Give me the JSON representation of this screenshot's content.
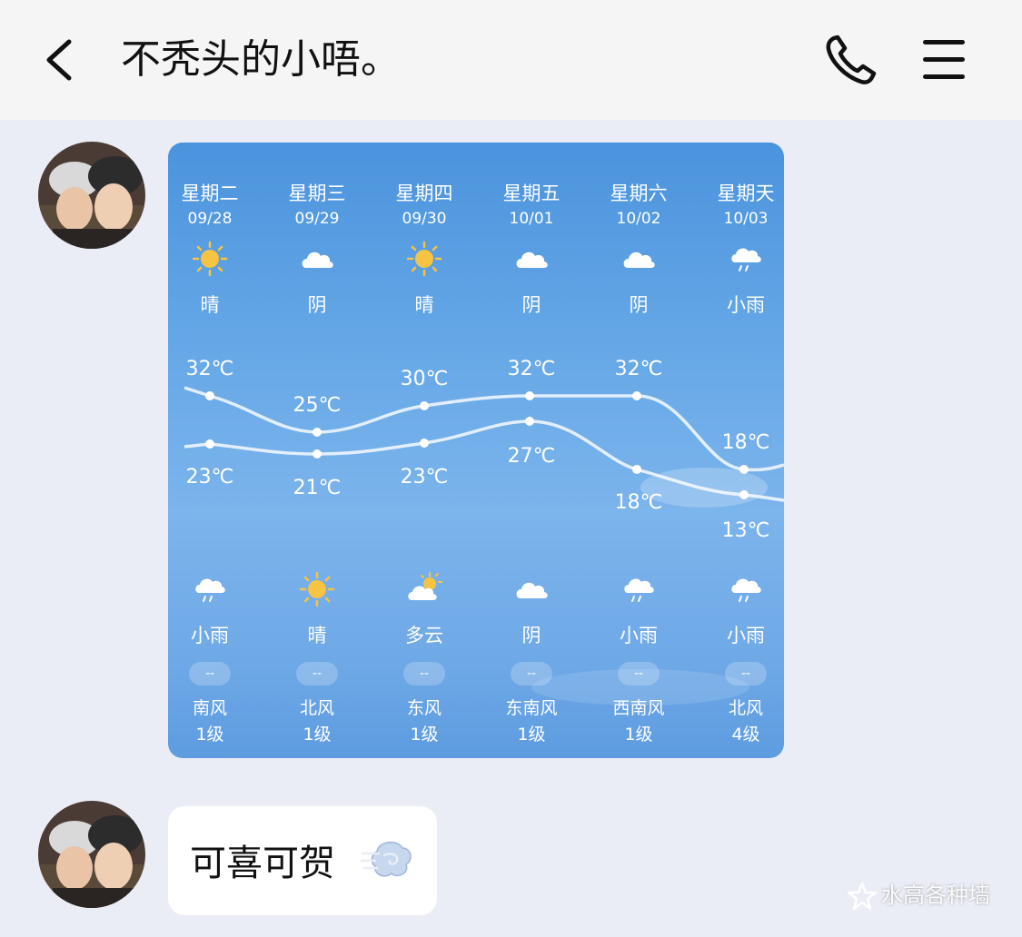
{
  "header": {
    "title": "不秃头的小唔。",
    "back_icon": "chevron-left-icon",
    "call_icon": "phone-icon",
    "menu_icon": "hamburger-menu-icon"
  },
  "messages": [
    {
      "type": "weather-card",
      "avatar": "couple-avatar",
      "days": [
        {
          "weekday": "星期二",
          "date": "09/28",
          "top_icon": "sun-icon",
          "top_condition": "晴",
          "high": "32℃",
          "low": "23℃",
          "bottom_icon": "cloud-rain-icon",
          "bottom_condition": "小雨",
          "wind_speed": "--",
          "wind_direction": "南风",
          "wind_level": "1级"
        },
        {
          "weekday": "星期三",
          "date": "09/29",
          "top_icon": "cloud-icon",
          "top_condition": "阴",
          "high": "25℃",
          "low": "21℃",
          "bottom_icon": "sun-icon",
          "bottom_condition": "晴",
          "wind_speed": "--",
          "wind_direction": "北风",
          "wind_level": "1级"
        },
        {
          "weekday": "星期四",
          "date": "09/30",
          "top_icon": "sun-icon",
          "top_condition": "晴",
          "high": "30℃",
          "low": "23℃",
          "bottom_icon": "partly-cloudy-icon",
          "bottom_condition": "多云",
          "wind_speed": "--",
          "wind_direction": "东风",
          "wind_level": "1级"
        },
        {
          "weekday": "星期五",
          "date": "10/01",
          "top_icon": "cloud-icon",
          "top_condition": "阴",
          "high": "32℃",
          "low": "27℃",
          "bottom_icon": "cloud-icon",
          "bottom_condition": "阴",
          "wind_speed": "--",
          "wind_direction": "东南风",
          "wind_level": "1级"
        },
        {
          "weekday": "星期六",
          "date": "10/02",
          "top_icon": "cloud-icon",
          "top_condition": "阴",
          "high": "32℃",
          "low": "18℃",
          "bottom_icon": "cloud-rain-icon",
          "bottom_condition": "小雨",
          "wind_speed": "--",
          "wind_direction": "西南风",
          "wind_level": "1级"
        },
        {
          "weekday": "星期天",
          "date": "10/03",
          "top_icon": "cloud-rain-icon",
          "top_condition": "小雨",
          "high": "18℃",
          "low": "13℃",
          "bottom_icon": "cloud-rain-icon",
          "bottom_condition": "小雨",
          "wind_speed": "--",
          "wind_direction": "北风",
          "wind_level": "4级"
        }
      ]
    },
    {
      "type": "text",
      "avatar": "couple-avatar",
      "text": "可喜可贺",
      "emoji": "dash-emoji-icon"
    }
  ],
  "watermark": {
    "text": "水高各种墙",
    "icon": "star-logo-icon"
  },
  "colors": {
    "header_bg": "#f5f5f6",
    "chat_bg": "#ebedf6",
    "card_sky_top": "#4b93dd",
    "card_sky_bottom": "#7cb4ec",
    "sun": "#f6c343",
    "bubble_bg": "#ffffff"
  }
}
